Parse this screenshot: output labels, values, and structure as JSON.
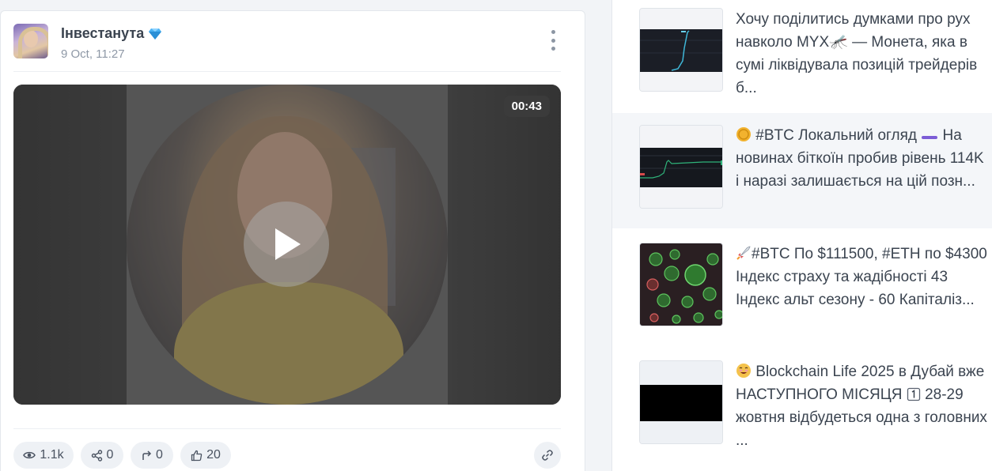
{
  "post": {
    "author_name": "Інвестанута",
    "date": "9 Oct, 11:27",
    "video_duration": "00:43",
    "stats": {
      "views": "1.1k",
      "shares": "0",
      "reposts": "0",
      "likes": "20"
    }
  },
  "feed": {
    "items": [
      {
        "text": "Хочу поділитись думками про рух навколо MYX🦟 — Монета, яка в сумі ліквідувала позицій трейдерів б..."
      },
      {
        "text_after_emoji": "#BTC Локальний огляд",
        "text_rest": "На новинах біткоїн пробив рівень 114K і наразі залишається на цій позн..."
      },
      {
        "text_after_emoji": "#BTC По $111500, #ETH по $4300 Індекс страху та жадібності 43 Індекс альт сезону - 60 Капіталіз..."
      },
      {
        "text_after_emoji": "Blockchain Life 2025 в Дубай вже НАСТУПНОГО МІСЯЦЯ",
        "text_rest": "28-29 жовтня відбудеться одна з головних ..."
      }
    ]
  },
  "colors": {
    "accent_purple": "#7b5cd6",
    "background": "#f2f4f7",
    "text": "#3b4450"
  }
}
